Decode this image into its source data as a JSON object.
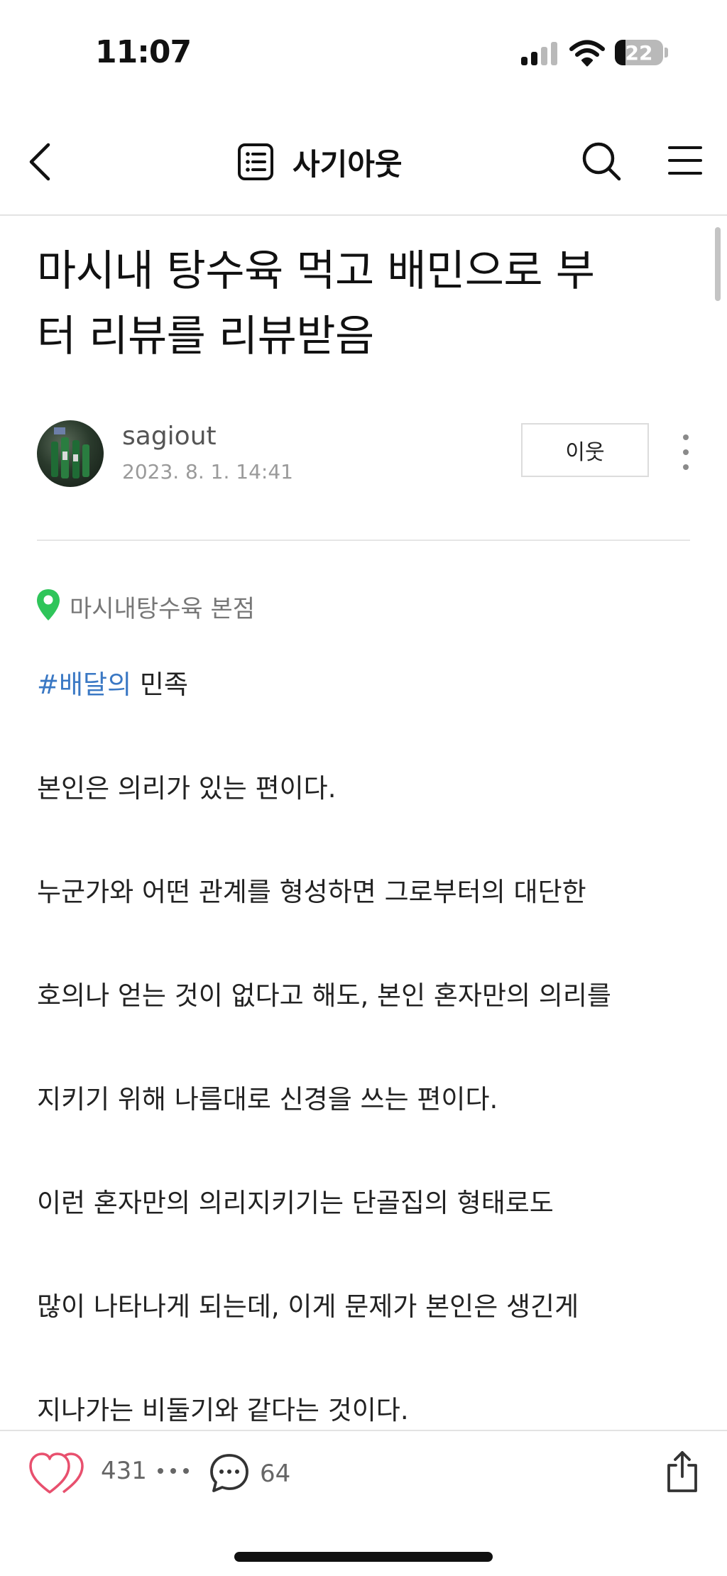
{
  "status_bar": {
    "time": "11:07",
    "battery": "22",
    "battery_level": 0.22
  },
  "nav": {
    "title": "사기아웃"
  },
  "post": {
    "title_lines": [
      "마시내 탕수육 먹고 배민으로 부",
      "터 리뷰를 리뷰받음"
    ],
    "author": "sagiout",
    "date": "2023. 8. 1. 14:41",
    "follow_label": "이웃",
    "location": "마시내탕수육 본점",
    "hashtag": "#배달의",
    "hashtag_rest": " 민족",
    "body_lines": [
      "본인은 의리가 있는 편이다.",
      "누군가와 어떤 관계를 형성하면 그로부터의 대단한",
      "호의나 얻는 것이 없다고 해도, 본인 혼자만의 의리를",
      "지키기 위해 나름대로 신경을 쓰는 편이다.",
      "이런 혼자만의 의리지키기는 단골집의 형태로도",
      "많이 나타나게 되는데, 이게 문제가 본인은 생긴게",
      "지나가는 비둘기와 같다는 것이다."
    ]
  },
  "bottom_bar": {
    "likes": "431",
    "comments": "64"
  },
  "colors": {
    "hashtag": "#3a78c4",
    "heart": "#e8506e",
    "pin": "#2fc55a"
  },
  "icons": [
    "back-icon",
    "list-icon",
    "search-icon",
    "menu-icon",
    "more-vert-icon",
    "location-pin-icon",
    "heart-icon",
    "dots-icon",
    "comment-icon",
    "share-icon"
  ]
}
